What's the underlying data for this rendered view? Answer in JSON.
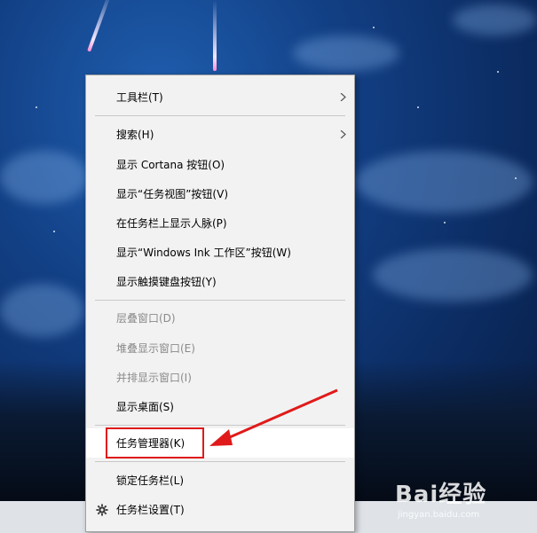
{
  "menu": {
    "items": [
      {
        "label": "工具栏(T)",
        "enabled": true,
        "submenu": true
      },
      {
        "label": "搜索(H)",
        "enabled": true,
        "submenu": true
      },
      {
        "label": "显示 Cortana 按钮(O)",
        "enabled": true
      },
      {
        "label": "显示“任务视图”按钮(V)",
        "enabled": true
      },
      {
        "label": "在任务栏上显示人脉(P)",
        "enabled": true
      },
      {
        "label": "显示“Windows Ink 工作区”按钮(W)",
        "enabled": true
      },
      {
        "label": "显示触摸键盘按钮(Y)",
        "enabled": true
      },
      {
        "label": "层叠窗口(D)",
        "enabled": false
      },
      {
        "label": "堆叠显示窗口(E)",
        "enabled": false
      },
      {
        "label": "并排显示窗口(I)",
        "enabled": false
      },
      {
        "label": "显示桌面(S)",
        "enabled": true
      },
      {
        "label": "任务管理器(K)",
        "enabled": true,
        "highlighted": true
      },
      {
        "label": "锁定任务栏(L)",
        "enabled": true
      },
      {
        "label": "任务栏设置(T)",
        "enabled": true,
        "icon": "gear-icon"
      }
    ]
  },
  "annotation": {
    "box_color": "#e01a1a",
    "arrow_color": "#e01a1a"
  },
  "watermark": {
    "logo": "Bai经验",
    "url": "jingyan.baidu.com"
  }
}
